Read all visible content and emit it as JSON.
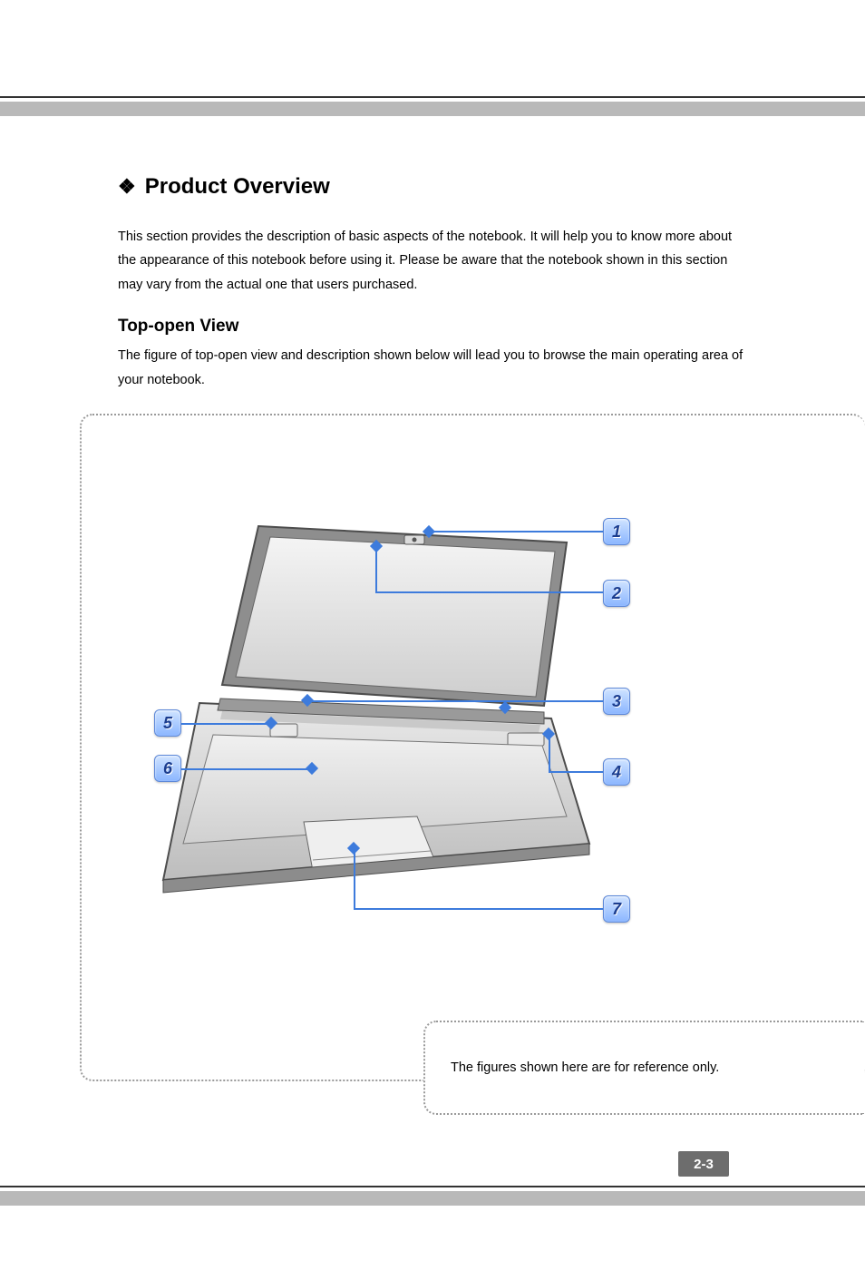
{
  "heading": "Product Overview",
  "intro": "This section provides the description of basic aspects of the notebook.  It will help you to know more about the appearance of this notebook before using it. Please be aware that the notebook shown in this section may vary from the actual one that users purchased.",
  "subheading": "Top-open View",
  "subintro": "The figure of top-open view and description shown below will lead you to browse the main operating area of your notebook.",
  "callouts": {
    "c1": "1",
    "c2": "2",
    "c3": "3",
    "c4": "4",
    "c5": "5",
    "c6": "6",
    "c7": "7"
  },
  "caption": "The figures shown here are for reference only.",
  "page_number": "2-3"
}
